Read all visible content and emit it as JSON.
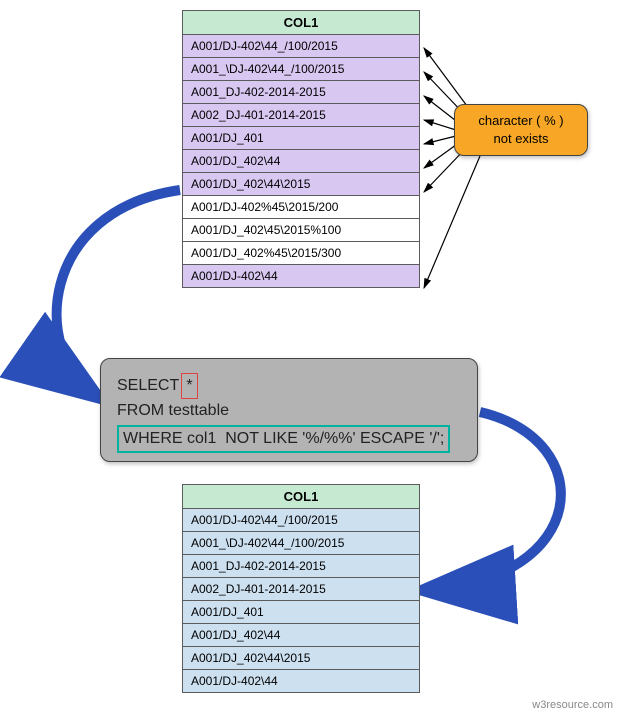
{
  "source_table": {
    "header": "COL1",
    "rows": [
      {
        "value": "A001/DJ-402\\44_/100/2015",
        "highlight": true
      },
      {
        "value": "A001_\\DJ-402\\44_/100/2015",
        "highlight": true
      },
      {
        "value": "A001_DJ-402-2014-2015",
        "highlight": true
      },
      {
        "value": "A002_DJ-401-2014-2015",
        "highlight": true
      },
      {
        "value": "A001/DJ_401",
        "highlight": true
      },
      {
        "value": "A001/DJ_402\\44",
        "highlight": true
      },
      {
        "value": "A001/DJ_402\\44\\2015",
        "highlight": true
      },
      {
        "value": "A001/DJ-402%45\\2015/200",
        "highlight": false
      },
      {
        "value": "A001/DJ_402\\45\\2015%100",
        "highlight": false
      },
      {
        "value": "A001/DJ_402%45\\2015/300",
        "highlight": false
      },
      {
        "value": "A001/DJ-402\\44",
        "highlight": true
      }
    ]
  },
  "result_table": {
    "header": "COL1",
    "rows": [
      "A001/DJ-402\\44_/100/2015",
      "A001_\\DJ-402\\44_/100/2015",
      "A001_DJ-402-2014-2015",
      "A002_DJ-401-2014-2015",
      "A001/DJ_401",
      "A001/DJ_402\\44",
      "A001/DJ_402\\44\\2015",
      "A001/DJ-402\\44"
    ]
  },
  "callout": {
    "line1": "character ( % )",
    "line2": "not exists"
  },
  "sql": {
    "select_kw": "SELECT",
    "star": "*",
    "from_line": "FROM testtable",
    "where_line": "WHERE col1  NOT LIKE '%/%%' ESCAPE '/';"
  },
  "credit": "w3resource.com",
  "colors": {
    "header_bg": "#c6e9d2",
    "match_bg": "#d8c7f0",
    "nomatch_bg": "#ffffff",
    "result_bg": "#cde0f0",
    "callout_bg": "#f7a625",
    "sqlbox_bg": "#b3b3b3",
    "arrow": "#2a4fb8"
  }
}
